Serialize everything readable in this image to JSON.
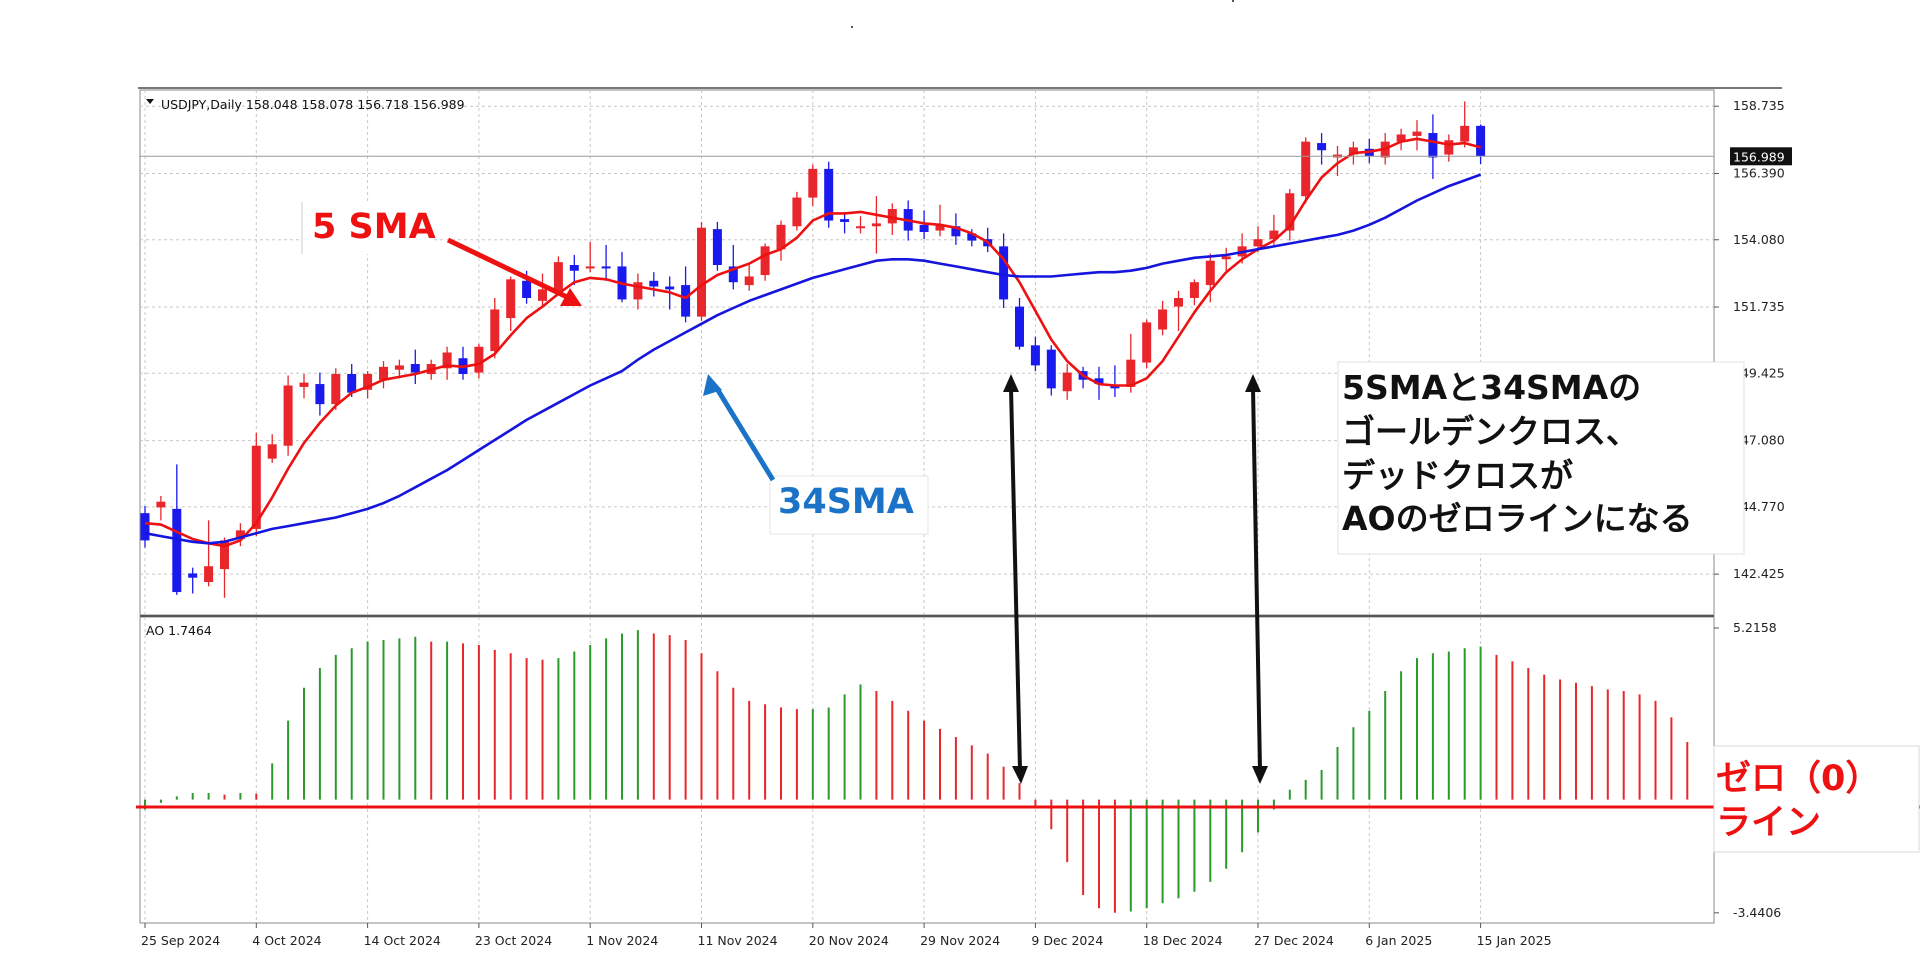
{
  "header": {
    "symbol_label": "USDJPY,Daily  158.048 158.078 156.718 156.989",
    "ao_label": "AO 1.7464"
  },
  "annotations": {
    "sma5_label": "5 SMA",
    "sma34_label": "34SMA",
    "note_lines": [
      "5SMAと34SMAの",
      "ゴールデンクロス、",
      "デッドクロスが",
      "AOのゼロラインになる"
    ],
    "zero_line_lines": [
      "ゼロ（0）",
      "ライン"
    ]
  },
  "colors": {
    "bull_candle": "#e8262b",
    "bear_candle": "#1a1aee",
    "sma5": "#ee1111",
    "sma34": "#1515dd",
    "ao_up": "#2b9a2b",
    "ao_down": "#e8262b",
    "zero_line": "#ee1111",
    "arrow_red": "#ee1111",
    "arrow_blue": "#1a73c6"
  },
  "chart_data": [
    {
      "type": "candlestick",
      "title": "USDJPY,Daily",
      "price_axis_ticks": [
        "158.735",
        "156.390",
        "154.080",
        "151.735",
        "149.425",
        "147.080",
        "144.770",
        "142.425"
      ],
      "price_axis_tick_values": [
        158.735,
        156.39,
        154.08,
        151.735,
        149.425,
        147.08,
        144.77,
        142.425
      ],
      "current_price_label": "156.989",
      "current_price": 156.989,
      "ylim": [
        141.0,
        159.3
      ],
      "date_labels": [
        "25 Sep 2024",
        "4 Oct 2024",
        "14 Oct 2024",
        "23 Oct 2024",
        "1 Nov 2024",
        "11 Nov 2024",
        "20 Nov 2024",
        "29 Nov 2024",
        "9 Dec 2024",
        "18 Dec 2024",
        "27 Dec 2024",
        "6 Jan 2025",
        "15 Jan 2025"
      ],
      "date_label_bar_index": [
        0,
        7,
        14,
        21,
        28,
        35,
        42,
        49,
        56,
        63,
        70,
        77,
        84
      ],
      "ohlc": [
        [
          144.55,
          144.8,
          143.35,
          143.6
        ],
        [
          144.75,
          145.15,
          144.3,
          144.95
        ],
        [
          144.7,
          146.25,
          141.7,
          141.8
        ],
        [
          142.45,
          142.65,
          141.75,
          142.3
        ],
        [
          142.15,
          144.3,
          142.0,
          142.7
        ],
        [
          142.6,
          143.7,
          141.6,
          143.6
        ],
        [
          143.65,
          144.2,
          143.4,
          143.95
        ],
        [
          144.0,
          147.35,
          143.75,
          146.9
        ],
        [
          146.45,
          147.3,
          146.3,
          146.95
        ],
        [
          146.9,
          149.35,
          146.55,
          149.0
        ],
        [
          148.95,
          149.4,
          148.55,
          149.1
        ],
        [
          149.05,
          149.45,
          147.95,
          148.35
        ],
        [
          148.35,
          149.6,
          148.15,
          149.4
        ],
        [
          149.4,
          149.75,
          148.6,
          148.75
        ],
        [
          148.85,
          149.5,
          148.55,
          149.4
        ],
        [
          149.2,
          149.85,
          148.9,
          149.65
        ],
        [
          149.55,
          149.9,
          149.25,
          149.7
        ],
        [
          149.75,
          150.25,
          149.05,
          149.45
        ],
        [
          149.4,
          149.9,
          149.2,
          149.75
        ],
        [
          149.6,
          150.35,
          149.2,
          150.15
        ],
        [
          149.95,
          150.35,
          149.2,
          149.4
        ],
        [
          149.45,
          150.45,
          149.25,
          150.35
        ],
        [
          150.2,
          152.05,
          149.95,
          151.65
        ],
        [
          151.35,
          152.8,
          150.9,
          152.7
        ],
        [
          152.65,
          153.0,
          151.85,
          152.05
        ],
        [
          151.95,
          152.9,
          151.75,
          152.35
        ],
        [
          152.25,
          153.5,
          152.15,
          153.3
        ],
        [
          153.2,
          153.55,
          152.5,
          153.0
        ],
        [
          153.1,
          154.0,
          152.95,
          153.15
        ],
        [
          153.15,
          153.9,
          152.65,
          153.1
        ],
        [
          153.15,
          153.65,
          151.9,
          152.0
        ],
        [
          152.0,
          152.9,
          151.65,
          152.6
        ],
        [
          152.65,
          152.95,
          152.1,
          152.45
        ],
        [
          152.45,
          152.8,
          151.65,
          152.35
        ],
        [
          152.5,
          153.15,
          151.2,
          151.4
        ],
        [
          151.4,
          154.7,
          151.25,
          154.5
        ],
        [
          154.45,
          154.7,
          153.0,
          153.2
        ],
        [
          153.15,
          153.9,
          152.35,
          152.6
        ],
        [
          152.5,
          153.2,
          152.3,
          152.8
        ],
        [
          152.85,
          153.95,
          152.65,
          153.85
        ],
        [
          153.75,
          154.75,
          153.35,
          154.6
        ],
        [
          154.55,
          155.75,
          154.4,
          155.55
        ],
        [
          155.55,
          156.7,
          155.25,
          156.55
        ],
        [
          156.55,
          156.8,
          154.5,
          154.75
        ],
        [
          154.8,
          155.05,
          154.3,
          154.7
        ],
        [
          154.55,
          154.9,
          154.3,
          154.55
        ],
        [
          154.55,
          155.6,
          153.6,
          154.65
        ],
        [
          154.65,
          155.35,
          154.25,
          155.15
        ],
        [
          155.15,
          155.45,
          154.05,
          154.4
        ],
        [
          154.6,
          155.1,
          154.1,
          154.35
        ],
        [
          154.4,
          155.3,
          154.2,
          154.6
        ],
        [
          154.55,
          155.0,
          153.9,
          154.2
        ],
        [
          154.3,
          154.45,
          153.85,
          154.05
        ],
        [
          154.1,
          154.5,
          153.65,
          153.85
        ],
        [
          153.85,
          154.3,
          151.7,
          152.0
        ],
        [
          151.75,
          152.05,
          150.25,
          150.35
        ],
        [
          150.4,
          150.7,
          149.5,
          149.7
        ],
        [
          150.25,
          150.4,
          148.65,
          148.9
        ],
        [
          148.8,
          149.75,
          148.5,
          149.45
        ],
        [
          149.5,
          149.65,
          148.9,
          149.2
        ],
        [
          149.25,
          149.65,
          148.5,
          149.05
        ],
        [
          149.0,
          149.7,
          148.6,
          148.9
        ],
        [
          148.95,
          150.8,
          148.75,
          149.9
        ],
        [
          149.8,
          151.3,
          149.6,
          151.2
        ],
        [
          150.95,
          151.95,
          150.75,
          151.65
        ],
        [
          151.75,
          152.3,
          150.9,
          152.05
        ],
        [
          152.05,
          152.7,
          151.8,
          152.6
        ],
        [
          152.5,
          153.6,
          151.9,
          153.35
        ],
        [
          153.4,
          153.8,
          152.95,
          153.5
        ],
        [
          153.5,
          154.3,
          153.25,
          153.85
        ],
        [
          153.85,
          154.55,
          153.65,
          154.1
        ],
        [
          154.1,
          154.95,
          153.9,
          154.4
        ],
        [
          154.4,
          155.85,
          154.05,
          155.7
        ],
        [
          155.6,
          157.65,
          155.35,
          157.5
        ],
        [
          157.45,
          157.8,
          156.7,
          157.2
        ],
        [
          156.95,
          157.35,
          156.3,
          157.05
        ],
        [
          157.05,
          157.5,
          156.7,
          157.3
        ],
        [
          157.25,
          157.6,
          156.75,
          157.0
        ],
        [
          156.95,
          157.8,
          156.7,
          157.5
        ],
        [
          157.5,
          157.95,
          157.2,
          157.75
        ],
        [
          157.7,
          158.25,
          157.2,
          157.85
        ],
        [
          157.8,
          158.45,
          156.2,
          156.95
        ],
        [
          157.05,
          157.75,
          156.8,
          157.55
        ],
        [
          157.5,
          158.9,
          157.3,
          158.05
        ],
        [
          158.05,
          158.1,
          156.72,
          156.99
        ]
      ],
      "series": [
        {
          "name": "5 SMA",
          "values": [
            144.2,
            144.15,
            143.9,
            143.65,
            143.5,
            143.4,
            143.6,
            144.2,
            145.1,
            146.1,
            147.0,
            147.7,
            148.3,
            148.75,
            148.95,
            149.2,
            149.3,
            149.4,
            149.55,
            149.7,
            149.65,
            149.75,
            150.1,
            150.75,
            151.35,
            151.75,
            152.2,
            152.6,
            152.75,
            152.7,
            152.55,
            152.45,
            152.35,
            152.25,
            152.05,
            152.5,
            152.85,
            153.05,
            153.25,
            153.55,
            153.75,
            154.15,
            154.75,
            155.0,
            155.0,
            155.05,
            154.95,
            154.85,
            154.75,
            154.65,
            154.6,
            154.5,
            154.3,
            154.0,
            153.4,
            152.6,
            151.6,
            150.6,
            149.85,
            149.35,
            149.05,
            149.0,
            149.0,
            149.25,
            149.85,
            150.7,
            151.55,
            152.3,
            152.95,
            153.4,
            153.75,
            154.05,
            154.55,
            155.45,
            156.25,
            156.75,
            157.1,
            157.15,
            157.25,
            157.5,
            157.6,
            157.5,
            157.4,
            157.45,
            157.3
          ]
        },
        {
          "name": "34SMA",
          "values": [
            143.85,
            143.75,
            143.65,
            143.55,
            143.5,
            143.55,
            143.7,
            143.85,
            144.0,
            144.1,
            144.2,
            144.3,
            144.4,
            144.55,
            144.7,
            144.9,
            145.15,
            145.45,
            145.75,
            146.05,
            146.4,
            146.75,
            147.1,
            147.45,
            147.8,
            148.1,
            148.4,
            148.7,
            149.0,
            149.25,
            149.5,
            149.9,
            150.25,
            150.55,
            150.85,
            151.15,
            151.45,
            151.7,
            151.95,
            152.15,
            152.35,
            152.55,
            152.75,
            152.9,
            153.05,
            153.2,
            153.35,
            153.4,
            153.4,
            153.35,
            153.25,
            153.15,
            153.05,
            152.95,
            152.85,
            152.8,
            152.8,
            152.8,
            152.85,
            152.9,
            152.95,
            152.95,
            153.0,
            153.1,
            153.25,
            153.35,
            153.45,
            153.5,
            153.55,
            153.65,
            153.75,
            153.85,
            153.95,
            154.05,
            154.15,
            154.25,
            154.4,
            154.6,
            154.85,
            155.15,
            155.45,
            155.7,
            155.95,
            156.15,
            156.35
          ]
        }
      ]
    },
    {
      "type": "bar",
      "title": "AO 1.7464",
      "axis_ticks": [
        "5.2158",
        "-3.4406"
      ],
      "axis_tick_values": [
        5.2158,
        -3.4406
      ],
      "ylim": [
        -3.75,
        5.55
      ],
      "series": [
        {
          "name": "AO",
          "values": [
            -0.3,
            -0.1,
            0.1,
            0.2,
            0.2,
            0.15,
            0.2,
            0.18,
            1.1,
            2.4,
            3.4,
            4.0,
            4.4,
            4.6,
            4.8,
            4.85,
            4.9,
            4.95,
            4.8,
            4.8,
            4.75,
            4.7,
            4.55,
            4.45,
            4.3,
            4.25,
            4.3,
            4.5,
            4.7,
            4.9,
            5.05,
            5.15,
            5.05,
            5.0,
            4.85,
            4.45,
            3.9,
            3.4,
            3.0,
            2.9,
            2.8,
            2.75,
            2.75,
            2.8,
            3.2,
            3.5,
            3.3,
            3.0,
            2.7,
            2.4,
            2.15,
            1.9,
            1.65,
            1.4,
            1.0,
            0.5,
            -0.2,
            -0.9,
            -1.9,
            -2.9,
            -3.3,
            -3.44,
            -3.4,
            -3.3,
            -3.15,
            -3.0,
            -2.8,
            -2.5,
            -2.1,
            -1.6,
            -1.0,
            -0.3,
            0.3,
            0.6,
            0.9,
            1.6,
            2.2,
            2.7,
            3.3,
            3.9,
            4.3,
            4.45,
            4.5,
            4.6,
            4.65,
            4.4,
            4.2,
            4.0,
            3.8,
            3.65,
            3.55,
            3.45,
            3.35,
            3.3,
            3.2,
            3.0,
            2.5,
            1.75
          ]
        }
      ]
    }
  ]
}
